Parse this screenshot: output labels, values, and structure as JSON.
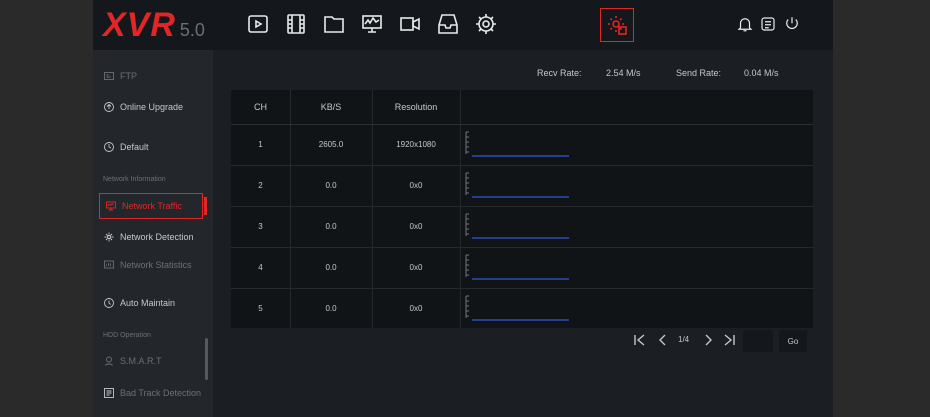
{
  "logo": {
    "brand": "XVR",
    "version": "5.0"
  },
  "toolbar": {
    "icons": [
      "playback-icon",
      "video-icon",
      "folder-icon",
      "monitor-icon",
      "camera-icon",
      "storage-icon",
      "settings-icon",
      "system-maintenance-icon"
    ],
    "active": "system-maintenance-icon"
  },
  "sidebar": {
    "items": [
      {
        "label": "FTP",
        "icon": "ftp-icon",
        "dim": true
      },
      {
        "label": "Online Upgrade",
        "icon": "upgrade-icon",
        "dim": false
      },
      {
        "label": "Default",
        "icon": "default-icon",
        "dim": false
      },
      {
        "label": "Network Information",
        "section": true
      },
      {
        "label": "Network Traffic",
        "icon": "network-traffic-icon",
        "active": true
      },
      {
        "label": "Network Detection",
        "icon": "network-detection-icon",
        "dim": false
      },
      {
        "label": "Network Statistics",
        "icon": "network-statistics-icon",
        "dim": true
      },
      {
        "label": "Auto Maintain",
        "icon": "auto-maintain-icon",
        "dim": false
      },
      {
        "label": "HDD Operation",
        "section": true
      },
      {
        "label": "S.M.A.R.T",
        "icon": "smart-icon",
        "dim": true
      },
      {
        "label": "Bad Track Detection",
        "icon": "bad-track-icon",
        "dim": true
      }
    ]
  },
  "rates": {
    "recv_label": "Recv Rate:",
    "recv_value": "2.54 M/s",
    "send_label": "Send Rate:",
    "send_value": "0.04 M/s"
  },
  "table": {
    "headers": [
      "CH",
      "KB/S",
      "Resolution"
    ],
    "rows": [
      {
        "ch": "1",
        "kbs": "2605.0",
        "res": "1920x1080"
      },
      {
        "ch": "2",
        "kbs": "0.0",
        "res": "0x0"
      },
      {
        "ch": "3",
        "kbs": "0.0",
        "res": "0x0"
      },
      {
        "ch": "4",
        "kbs": "0.0",
        "res": "0x0"
      },
      {
        "ch": "5",
        "kbs": "0.0",
        "res": "0x0"
      }
    ]
  },
  "pager": {
    "page": "1/4",
    "go": "Go"
  },
  "colors": {
    "accent": "#e02626",
    "graph_line": "#2f5bd6"
  }
}
